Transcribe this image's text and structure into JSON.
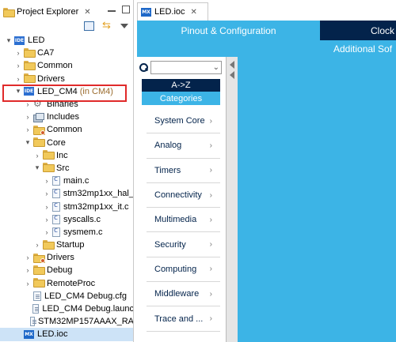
{
  "explorer": {
    "title": "Project Explorer",
    "close_glyph": "✕",
    "tree": [
      {
        "label": "LED",
        "depth": 0,
        "arrow": "▾",
        "icon": "ide-project-icon"
      },
      {
        "label": "CA7",
        "depth": 1,
        "arrow": "›",
        "icon": "folder-icon"
      },
      {
        "label": "Common",
        "depth": 1,
        "arrow": "›",
        "icon": "folder-icon"
      },
      {
        "label": "Drivers",
        "depth": 1,
        "arrow": "›",
        "icon": "folder-icon"
      },
      {
        "label": "LED_CM4",
        "decoration": "(in CM4)",
        "depth": 1,
        "arrow": "▾",
        "icon": "ide-project-icon"
      },
      {
        "label": "Binaries",
        "depth": 2,
        "arrow": "›",
        "icon": "binaries-icon"
      },
      {
        "label": "Includes",
        "depth": 2,
        "arrow": "›",
        "icon": "includes-icon"
      },
      {
        "label": "Common",
        "depth": 2,
        "arrow": "›",
        "icon": "linked-folder-icon"
      },
      {
        "label": "Core",
        "depth": 2,
        "arrow": "▾",
        "icon": "folder-icon"
      },
      {
        "label": "Inc",
        "depth": 3,
        "arrow": "›",
        "icon": "folder-icon"
      },
      {
        "label": "Src",
        "depth": 3,
        "arrow": "▾",
        "icon": "folder-icon"
      },
      {
        "label": "main.c",
        "depth": 4,
        "arrow": "›",
        "icon": "c-file-icon"
      },
      {
        "label": "stm32mp1xx_hal_",
        "depth": 4,
        "arrow": "›",
        "icon": "c-file-icon"
      },
      {
        "label": "stm32mp1xx_it.c",
        "depth": 4,
        "arrow": "›",
        "icon": "c-file-icon"
      },
      {
        "label": "syscalls.c",
        "depth": 4,
        "arrow": "›",
        "icon": "c-file-icon"
      },
      {
        "label": "sysmem.c",
        "depth": 4,
        "arrow": "›",
        "icon": "c-file-icon"
      },
      {
        "label": "Startup",
        "depth": 3,
        "arrow": "›",
        "icon": "folder-icon"
      },
      {
        "label": "Drivers",
        "depth": 2,
        "arrow": "›",
        "icon": "linked-folder-icon"
      },
      {
        "label": "Debug",
        "depth": 2,
        "arrow": "›",
        "icon": "folder-icon"
      },
      {
        "label": "RemoteProc",
        "depth": 2,
        "arrow": "›",
        "icon": "folder-icon"
      },
      {
        "label": "LED_CM4 Debug.cfg",
        "depth": 2,
        "arrow": "",
        "icon": "cfg-file-icon"
      },
      {
        "label": "LED_CM4 Debug.launc",
        "depth": 2,
        "arrow": "",
        "icon": "cfg-file-icon"
      },
      {
        "label": "STM32MP157AAAX_RA",
        "depth": 2,
        "arrow": "",
        "icon": "cfg-file-icon"
      },
      {
        "label": "LED.ioc",
        "depth": 1,
        "arrow": "",
        "icon": "mx-file-icon",
        "selected": true
      }
    ]
  },
  "editor": {
    "tab_label": "LED.ioc",
    "tab_icon_text": "MX",
    "close_glyph": "✕",
    "header": {
      "pinout_tab": "Pinout & Configuration",
      "clock_tab": "Clock C",
      "sub_label": "Additional Sof"
    },
    "sidebar": {
      "sort_button": "A->Z",
      "categories_button": "Categories",
      "chevron": "›",
      "categories": [
        "System Core",
        "Analog",
        "Timers",
        "Connectivity",
        "Multimedia",
        "Security",
        "Computing",
        "Middleware",
        "Trace and ..."
      ]
    }
  },
  "colors": {
    "cube_blue": "#3cb4e6",
    "cube_navy": "#03234b",
    "highlight_red": "#e02a2a",
    "selection": "#cde3f7"
  }
}
